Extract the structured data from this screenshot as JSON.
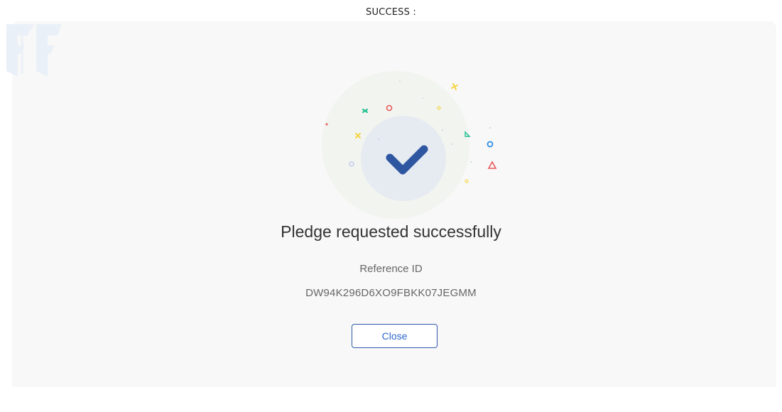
{
  "header": {
    "label": "SUCCESS :"
  },
  "modal": {
    "title": "Pledge requested successfully",
    "reference_label": "Reference ID",
    "reference_id": "DW94K296D6XO9FBKK07JEGMM",
    "close_label": "Close"
  },
  "icons": {
    "brand": "brand-logo-icon",
    "success": "checkmark-icon"
  },
  "colors": {
    "card_background": "#f8f8f8",
    "check": "#2f56a0",
    "button_border": "#2f5aa8",
    "button_text": "#2f6bd0"
  }
}
